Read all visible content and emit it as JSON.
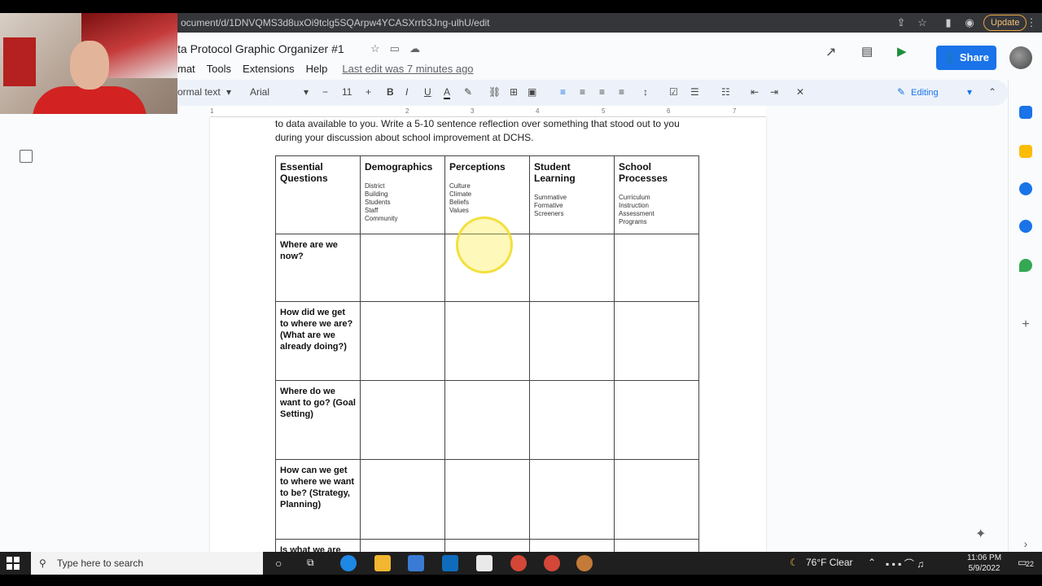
{
  "browser": {
    "url": "ocument/d/1DNVQMS3d8uxOi9tclg5SQArpw4YCASXrrb3Jng-ulhU/edit",
    "update_label": "Update"
  },
  "docs": {
    "title": "ta Protocol Graphic Organizer #1",
    "menu": [
      "mat",
      "Tools",
      "Extensions",
      "Help"
    ],
    "last_edit": "Last edit was 7 minutes ago",
    "share_label": "Share",
    "toolbar": {
      "style": "ormal text",
      "font": "Arial",
      "font_size": "11",
      "editing_label": "Editing"
    },
    "ruler_numbers": [
      "1",
      "2",
      "3",
      "4",
      "5",
      "6",
      "7"
    ]
  },
  "document": {
    "paragraph_line1": "to data available to you.  Write a 5-10 sentence reflection over something that stood out to you",
    "paragraph_line2": "during your discussion about school improvement at DCHS.",
    "table": {
      "headers": [
        {
          "title": "Essential Questions",
          "items": ""
        },
        {
          "title": "Demographics",
          "items": "District\nBuilding\nStudents\nStaff\nCommunity"
        },
        {
          "title": "Perceptions",
          "items": "Culture\nClimate\nBeliefs\nValues"
        },
        {
          "title": "Student Learning",
          "items": "Summative\nFormative\nScreeners"
        },
        {
          "title": "School Processes",
          "items": "Curriculum\nInstruction\nAssessment\nPrograms"
        }
      ],
      "rows": [
        "Where are we now?",
        "How did we get to where we are? (What are we already doing?)",
        "Where do we want to go? (Goal Setting)",
        "How can we get to where we want to be? (Strategy, Planning)",
        "Is what we are"
      ]
    }
  },
  "taskbar": {
    "search_placeholder": "Type here to search",
    "weather": "76°F  Clear",
    "time": "11:06 PM",
    "date": "5/9/2022",
    "notifications": "22"
  }
}
